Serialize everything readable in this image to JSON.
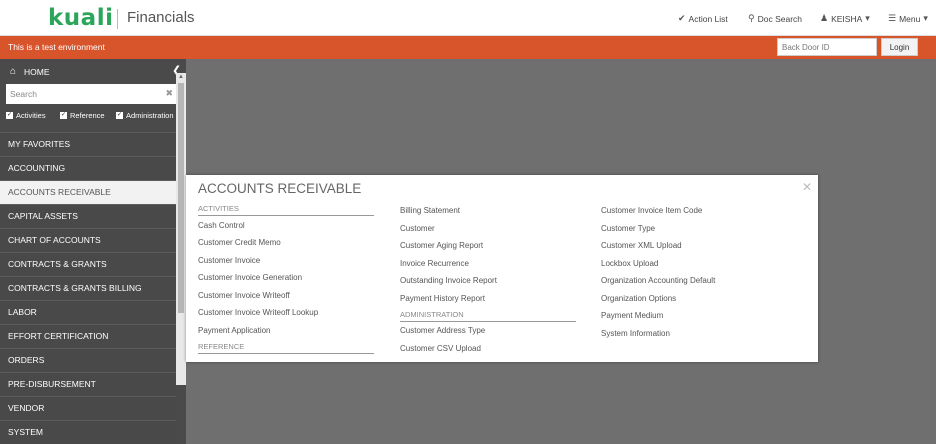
{
  "header": {
    "logo_text": "kuali",
    "app_title": "Financials",
    "action_list": "Action List",
    "doc_search": "Doc Search",
    "user": "KEISHA",
    "menu": "Menu",
    "icons": {
      "action_list": "check-circle-icon",
      "doc_search": "search-icon",
      "user": "user-icon",
      "menu": "hamburger-icon"
    }
  },
  "env_bar": {
    "message": "This is a test environment",
    "backdoor_placeholder": "Back Door ID",
    "login_label": "Login",
    "color": "#d8542b"
  },
  "sidebar": {
    "home_label": "HOME",
    "search_placeholder": "Search",
    "filters": [
      "Activities",
      "Reference",
      "Administration"
    ],
    "items": [
      "MY FAVORITES",
      "ACCOUNTING",
      "ACCOUNTS RECEIVABLE",
      "CAPITAL ASSETS",
      "CHART OF ACCOUNTS",
      "CONTRACTS & GRANTS",
      "CONTRACTS & GRANTS BILLING",
      "LABOR",
      "EFFORT CERTIFICATION",
      "ORDERS",
      "PRE-DISBURSEMENT",
      "VENDOR",
      "SYSTEM"
    ],
    "active_index": 2
  },
  "popup": {
    "title": "ACCOUNTS RECEIVABLE",
    "sections": {
      "activities": "ACTIVITIES",
      "reference": "REFERENCE",
      "administration": "ADMINISTRATION"
    },
    "col1": [
      "Cash Control",
      "Customer Credit Memo",
      "Customer Invoice",
      "Customer Invoice Generation",
      "Customer Invoice Writeoff",
      "Customer Invoice Writeoff Lookup",
      "Payment Application"
    ],
    "col2_reference": [
      "Billing Statement",
      "Customer",
      "Customer Aging Report",
      "Invoice Recurrence",
      "Outstanding Invoice Report",
      "Payment History Report"
    ],
    "col2_admin": [
      "Customer Address Type",
      "Customer CSV Upload"
    ],
    "col3": [
      "Customer Invoice Item Code",
      "Customer Type",
      "Customer XML Upload",
      "Lockbox Upload",
      "Organization Accounting Default",
      "Organization Options",
      "Payment Medium",
      "System Information"
    ]
  }
}
